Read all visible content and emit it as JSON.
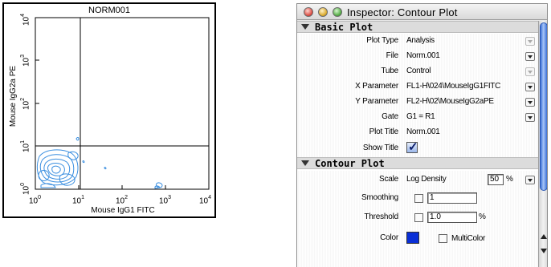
{
  "plot": {
    "title": "NORM001",
    "ylabel": "Mouse IgG2a PE",
    "xlabel": "Mouse IgG1 FITC",
    "xticks": [
      "10",
      "10",
      "10",
      "10",
      "10"
    ],
    "xexp": [
      "0",
      "1",
      "2",
      "3",
      "4"
    ],
    "yticks": [
      "10",
      "10",
      "10",
      "10",
      "10"
    ],
    "yexp": [
      "0",
      "1",
      "2",
      "3",
      "4"
    ],
    "contour_color": "#3b8fe0"
  },
  "inspector": {
    "title": "Inspector: Contour Plot",
    "basic_section": "Basic Plot",
    "contour_section": "Contour Plot",
    "rows": {
      "plot_type": {
        "label": "Plot Type",
        "value": "Analysis"
      },
      "file": {
        "label": "File",
        "value": "Norm.001"
      },
      "tube": {
        "label": "Tube",
        "value": "Control"
      },
      "x_param": {
        "label": "X Parameter",
        "value": "FL1-H\\024\\MouseIgG1FITC"
      },
      "y_param": {
        "label": "Y Parameter",
        "value": "FL2-H\\02\\MouseIgG2aPE"
      },
      "gate": {
        "label": "Gate",
        "value": "G1 = R1"
      },
      "plot_title": {
        "label": "Plot Title",
        "value": "Norm.001"
      },
      "show_title": {
        "label": "Show Title",
        "checked": true
      },
      "scale": {
        "label": "Scale",
        "value": "Log Density",
        "percent": "50",
        "percent_sign": "%"
      },
      "smoothing": {
        "label": "Smoothing",
        "value": "1"
      },
      "threshold": {
        "label": "Threshold",
        "value": "1.0",
        "percent_sign": "%"
      },
      "color": {
        "label": "Color",
        "swatch": "#0a2fd6",
        "multicolor_label": "MultiColor"
      }
    }
  }
}
